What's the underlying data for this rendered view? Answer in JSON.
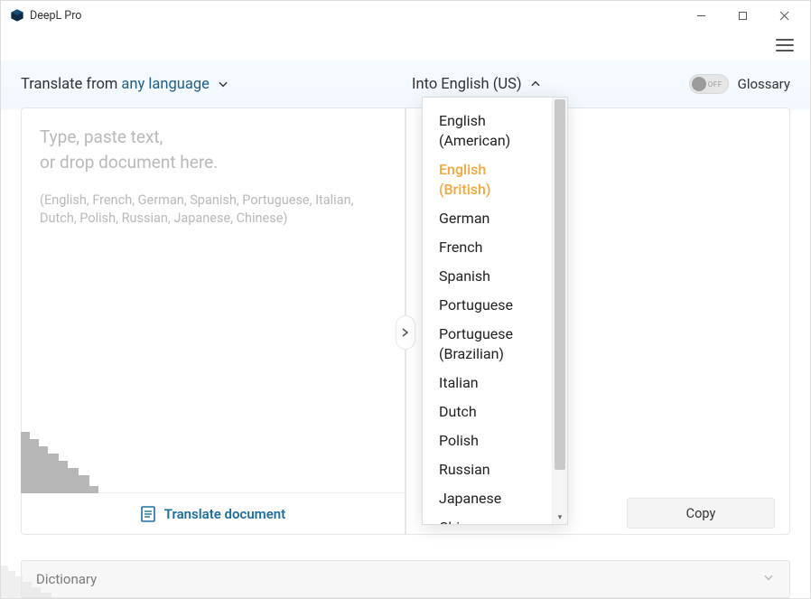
{
  "window": {
    "title": "DeepL Pro"
  },
  "header": {
    "source_prefix": "Translate from ",
    "source_lang": "any language",
    "target_prefix": "Into ",
    "target_lang": "English (US)",
    "glossary_label": "Glossary",
    "toggle_state": "OFF"
  },
  "source": {
    "placeholder_line1": "Type, paste text,",
    "placeholder_line2": "or drop document here.",
    "placeholder_langs": "(English, French, German, Spanish, Portuguese, Italian, Dutch, Polish, Russian, Japanese, Chinese)",
    "translate_doc": "Translate document"
  },
  "target": {
    "copy_label": "Copy"
  },
  "dictionary": {
    "label": "Dictionary"
  },
  "dropdown": {
    "items": [
      {
        "label": "English (American)",
        "selected": false
      },
      {
        "label": "English (British)",
        "selected": true
      },
      {
        "label": "German",
        "selected": false
      },
      {
        "label": "French",
        "selected": false
      },
      {
        "label": "Spanish",
        "selected": false
      },
      {
        "label": "Portuguese",
        "selected": false
      },
      {
        "label": "Portuguese (Brazilian)",
        "selected": false
      },
      {
        "label": "Italian",
        "selected": false
      },
      {
        "label": "Dutch",
        "selected": false
      },
      {
        "label": "Polish",
        "selected": false
      },
      {
        "label": "Russian",
        "selected": false
      },
      {
        "label": "Japanese",
        "selected": false
      },
      {
        "label": "Chinese",
        "selected": false
      }
    ]
  }
}
